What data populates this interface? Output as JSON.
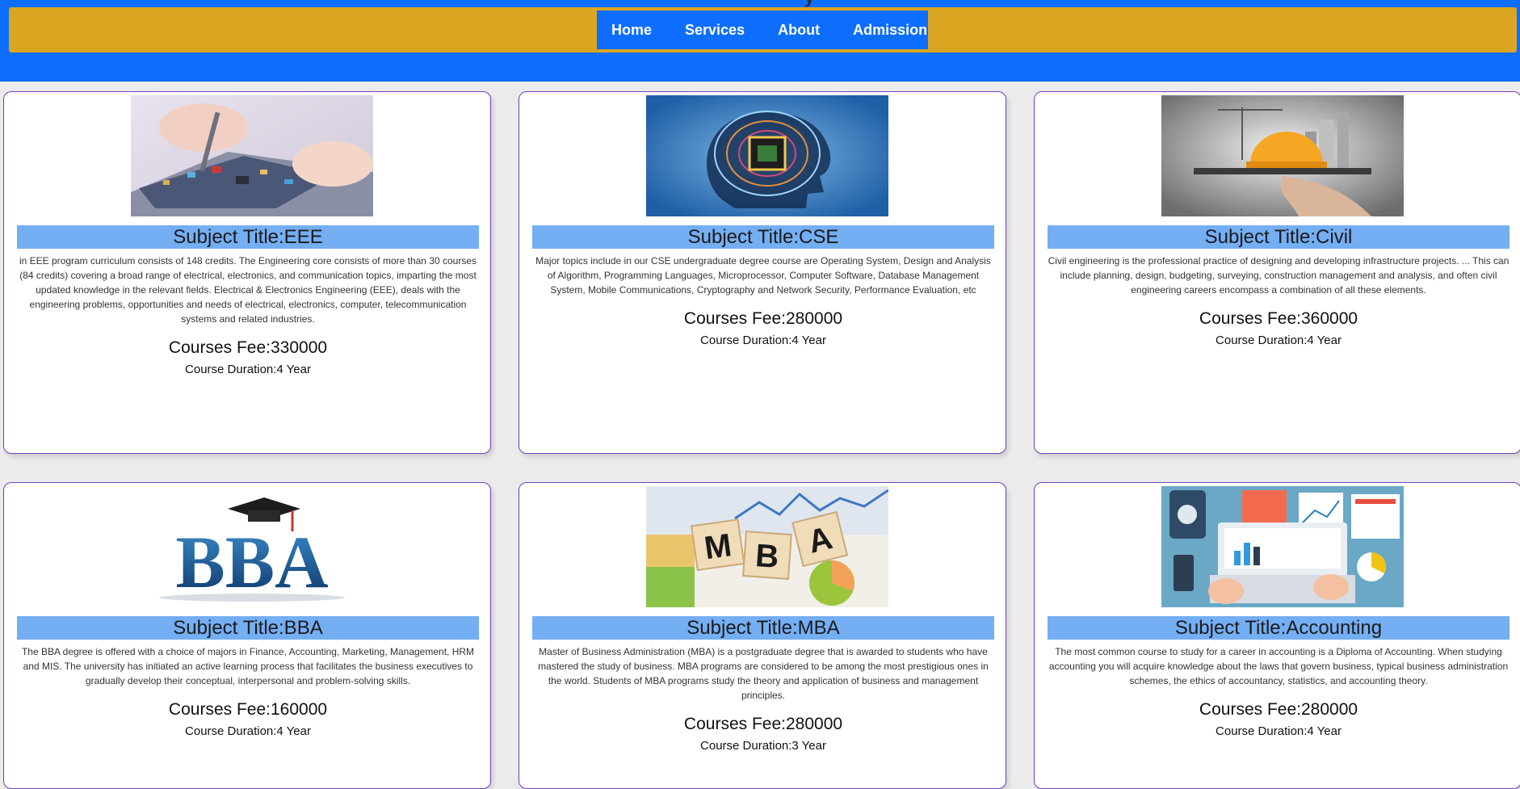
{
  "header": {
    "cut_text": "y"
  },
  "nav": {
    "items": [
      {
        "label": "Home"
      },
      {
        "label": "Services"
      },
      {
        "label": "About"
      },
      {
        "label": "Admission"
      }
    ]
  },
  "courses": [
    {
      "title": "Subject Title:EEE",
      "description": "in EEE program curriculum consists of 148 credits. The Engineering core consists of more than 30 courses (84 credits) covering a broad range of electrical, electronics, and communication topics, imparting the most updated knowledge in the relevant fields. Electrical & Electronics Engineering (EEE), deals with the engineering problems, opportunities and needs of electrical, electronics, computer, telecommunication systems and related industries.",
      "fee": "Courses Fee:330000",
      "duration": "Course Duration:4 Year"
    },
    {
      "title": "Subject Title:CSE",
      "description": "Major topics include in our CSE undergraduate degree course are Operating System, Design and Analysis of Algorithm, Programming Languages, Microprocessor, Computer Software, Database Management System, Mobile Communications, Cryptography and Network Security, Performance Evaluation, etc",
      "fee": "Courses Fee:280000",
      "duration": "Course Duration:4 Year"
    },
    {
      "title": "Subject Title:Civil",
      "description": "Civil engineering is the professional practice of designing and developing infrastructure projects. ... This can include planning, design, budgeting, surveying, construction management and analysis, and often civil engineering careers encompass a combination of all these elements.",
      "fee": "Courses Fee:360000",
      "duration": "Course Duration:4 Year"
    },
    {
      "title": "Subject Title:BBA",
      "image_text": "BBA",
      "description": "The BBA degree is offered with a choice of majors in Finance, Accounting, Marketing, Management, HRM and MIS. The university has initiated an active learning process that facilitates the business executives to gradually develop their conceptual, interpersonal and problem-solving skills.",
      "fee": "Courses Fee:160000",
      "duration": "Course Duration:4 Year"
    },
    {
      "title": "Subject Title:MBA",
      "image_text": [
        "M",
        "B",
        "A"
      ],
      "description": "Master of Business Administration (MBA) is a postgraduate degree that is awarded to students who have mastered the study of business. MBA programs are considered to be among the most prestigious ones in the world. Students of MBA programs study the theory and application of business and management principles.",
      "fee": "Courses Fee:280000",
      "duration": "Course Duration:3 Year"
    },
    {
      "title": "Subject Title:Accounting",
      "description": "The most common course to study for a career in accounting is a Diploma of Accounting. When studying accounting you will acquire knowledge about the laws that govern business, typical business administration schemes, the ethics of accountancy, statistics, and accounting theory.",
      "fee": "Courses Fee:280000",
      "duration": "Course Duration:4 Year"
    }
  ],
  "colors": {
    "header_blue": "#0d6efd",
    "navbar_gold": "#daa520",
    "title_bar": "#74aef3",
    "card_border": "#6f42c1"
  }
}
